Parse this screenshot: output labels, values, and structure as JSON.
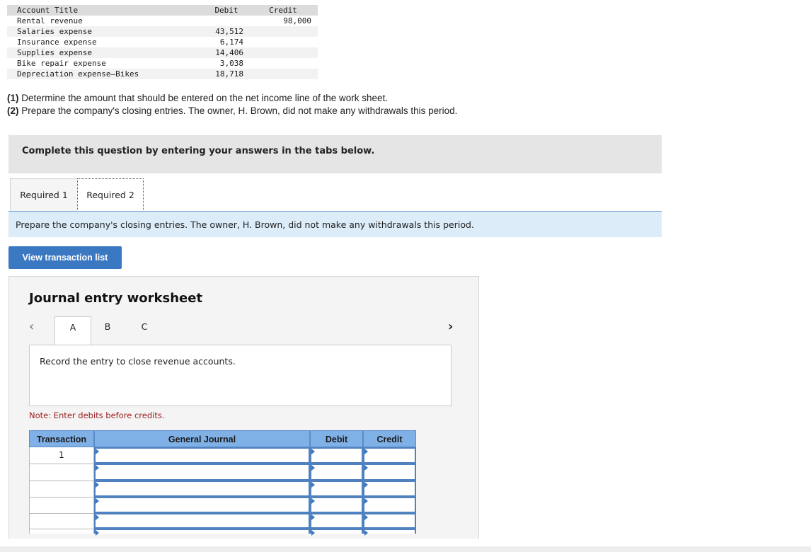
{
  "trial_balance": {
    "headers": {
      "account": "Account Title",
      "debit": "Debit",
      "credit": "Credit"
    },
    "rows": [
      {
        "account": "Rental revenue",
        "debit": "",
        "credit": "98,000"
      },
      {
        "account": "Salaries expense",
        "debit": "43,512",
        "credit": ""
      },
      {
        "account": "Insurance expense",
        "debit": "6,174",
        "credit": ""
      },
      {
        "account": "Supplies expense",
        "debit": "14,406",
        "credit": ""
      },
      {
        "account": "Bike repair expense",
        "debit": "3,038",
        "credit": ""
      },
      {
        "account": "Depreciation expense—Bikes",
        "debit": "18,718",
        "credit": ""
      }
    ]
  },
  "questions": [
    {
      "num": "(1)",
      "text": " Determine the amount that should be entered on the net income line of the work sheet."
    },
    {
      "num": "(2)",
      "text": " Prepare the company's closing entries. The owner, H. Brown, did not make any withdrawals this period."
    }
  ],
  "banner": "Complete this question by entering your answers in the tabs below.",
  "tabs": [
    "Required 1",
    "Required 2"
  ],
  "instruction": "Prepare the company's closing entries. The owner, H. Brown, did not make any withdrawals this period.",
  "view_button": "View transaction list",
  "worksheet": {
    "title": "Journal entry worksheet",
    "entry_tabs": [
      "A",
      "B",
      "C"
    ],
    "description": "Record the entry to close revenue accounts.",
    "note": "Note: Enter debits before credits.",
    "columns": [
      "Transaction",
      "General Journal",
      "Debit",
      "Credit"
    ],
    "rows": [
      {
        "transaction": "1"
      },
      {
        "transaction": ""
      },
      {
        "transaction": ""
      },
      {
        "transaction": ""
      },
      {
        "transaction": ""
      },
      {
        "transaction": ""
      }
    ]
  }
}
